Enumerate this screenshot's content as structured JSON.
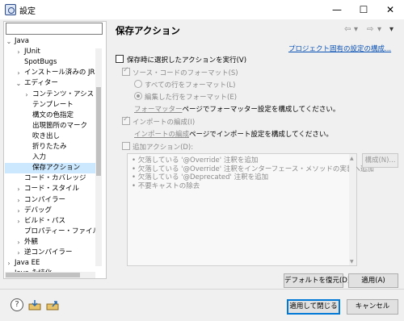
{
  "window": {
    "title": "設定",
    "minimize_label": "—",
    "maximize_label": "☐",
    "close_label": "✕"
  },
  "tree": {
    "filter_value": "",
    "items": [
      {
        "label": "Java",
        "arrow": "⌄"
      },
      {
        "label": "JUnit",
        "arrow": "›"
      },
      {
        "label": "SpotBugs",
        "arrow": ""
      },
      {
        "label": "インストール済みの JRE",
        "arrow": "›"
      },
      {
        "label": "エディター",
        "arrow": "⌄"
      },
      {
        "label": "コンテンツ・アシスト",
        "arrow": "›"
      },
      {
        "label": "テンプレート",
        "arrow": ""
      },
      {
        "label": "構文の色指定",
        "arrow": ""
      },
      {
        "label": "出現箇所のマーク",
        "arrow": ""
      },
      {
        "label": "吹き出し",
        "arrow": ""
      },
      {
        "label": "折りたたみ",
        "arrow": ""
      },
      {
        "label": "入力",
        "arrow": ""
      },
      {
        "label": "保存アクション",
        "arrow": ""
      },
      {
        "label": "コード・カバレッジ",
        "arrow": ""
      },
      {
        "label": "コード・スタイル",
        "arrow": "›"
      },
      {
        "label": "コンパイラー",
        "arrow": "›"
      },
      {
        "label": "デバッグ",
        "arrow": "›"
      },
      {
        "label": "ビルド・パス",
        "arrow": "›"
      },
      {
        "label": "プロパティー・ファイル・エデ",
        "arrow": ""
      },
      {
        "label": "外観",
        "arrow": "›"
      },
      {
        "label": "逆コンパイラー",
        "arrow": "›"
      },
      {
        "label": "Java EE",
        "arrow": "›"
      },
      {
        "label": "Java 永続化",
        "arrow": "›"
      }
    ]
  },
  "page": {
    "title": "保存アクション",
    "nav_back": "⇦",
    "nav_forward": "⇨",
    "nav_menu": "▾",
    "project_link": "プロジェクト固有の設定の構成...",
    "perform_on_save": "保存時に選択したアクションを実行(V)",
    "format_source": "ソース・コードのフォーマット(S)",
    "format_all": "すべての行をフォーマット(L)",
    "format_edited": "編集した行をフォーマット(E)",
    "formatter_link": "フォーマッター",
    "formatter_rest": "ページでフォーマッター設定を構成してください。",
    "organize_imports": "インポートの編成(I)",
    "organize_link": "インポートの編成",
    "organize_rest": "ページでインポート設定を構成してください。",
    "additional_actions": "追加アクション(D):",
    "actions": [
      "欠落している '@Override' 注釈を追加",
      "欠落している '@Override' 注釈をインターフェース・メソッドの実装へ追加",
      "欠落している '@Deprecated' 注釈を追加",
      "不要キャストの除去"
    ],
    "configure_button": "構成(N)...",
    "restore_defaults": "デフォルトを復元(D)",
    "apply": "適用(A)"
  },
  "footer": {
    "help": "?",
    "apply_close": "適用して閉じる",
    "cancel": "キャンセル"
  }
}
